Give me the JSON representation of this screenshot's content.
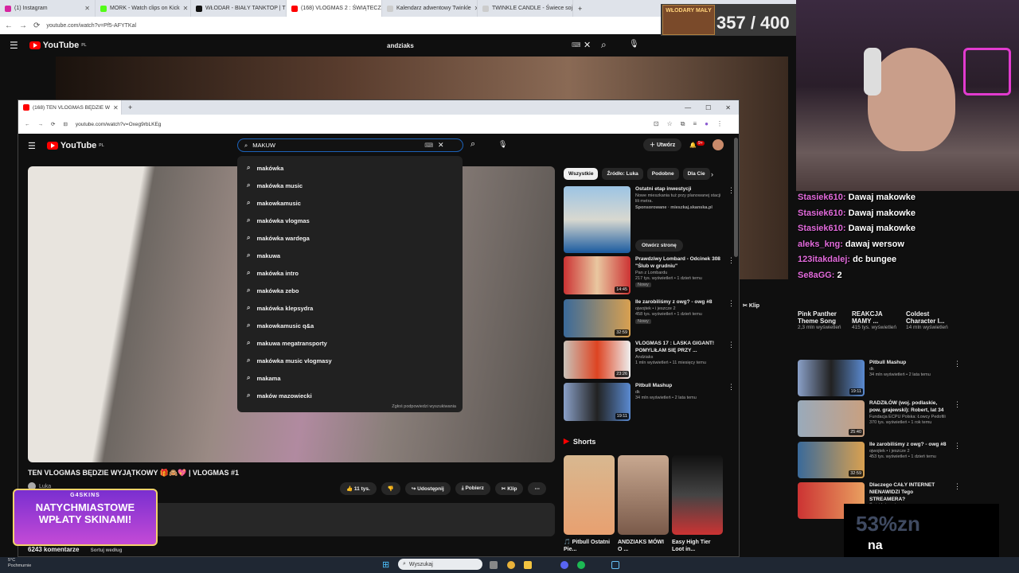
{
  "outer_tabs": [
    {
      "label": "(1) Instagram",
      "color": "#d6249f"
    },
    {
      "label": "MORK - Watch clips on Kick",
      "color": "#53fc18"
    },
    {
      "label": "WŁODAR - BIAŁY TANKTOP | T",
      "color": "#111111"
    },
    {
      "label": "(168) VLOGMAS 2 : ŚWIĄTECZ",
      "color": "#ff0000"
    },
    {
      "label": "Kalendarz adwentowy Twinkle",
      "color": "#cccccc"
    },
    {
      "label": "TWINKLE CANDLE - Świece soj",
      "color": "#cccccc"
    }
  ],
  "outer_url": "youtube.com/watch?v=Pf5-AFYTKal",
  "outer_logo": "YouTube",
  "outer_logo_region": "PL",
  "outer_search_value": "andziaks",
  "counter_badge": "WŁODARY MAŁY",
  "counter": "357 / 400",
  "inner_tab": "(168) TEN VLOGMAS BĘDZIE W",
  "inner_url": "youtube.com/watch?v=Oxeg9rbLKEg",
  "inner_search_value": "MAKUW",
  "suggestions": [
    "makówka",
    "makówka music",
    "makowkamusic",
    "makówka vlogmas",
    "makówka wardega",
    "makuwa",
    "makówka intro",
    "makówka zebo",
    "makówka klepsydra",
    "makowkamusic q&a",
    "makuwa megatransporty",
    "makówka music vlogmasy",
    "makama",
    "maków mazowiecki"
  ],
  "suggest_footer": "Zgłoś podpowiedzi wyszukiwania",
  "create_label": "Utwórz",
  "notif_count": "9+",
  "video_title": "TEN VLOGMAS BĘDZIE WYJĄTKOWY 🎁🙈💖 | VLOGMAS #1",
  "channel": "Luka",
  "actions": {
    "likes": "11 tys.",
    "share": "Udostępnij",
    "download": "Pobierz",
    "clip": "Klip"
  },
  "comments_count": "6243 komentarze",
  "sort_label": "Sortuj według",
  "chips": [
    "Wszystkie",
    "Źródło: Luka",
    "Podobne",
    "Dla Cie"
  ],
  "ad": {
    "title": "Ostatni etap inwestycji",
    "desc": "Nowe mieszkania tuż przy planowanej stacji lili metra.",
    "sponsor": "Sponsorowane · mieszkaj.skanska.pl",
    "cta": "Otwórz stronę"
  },
  "recos": [
    {
      "title": "Prawdziwy Lombard - Odcinek 308 \"Ślub w grudniu\"",
      "channel": "Pan z Lombardu",
      "meta": "217 tys. wyświetleń • 1 dzień temu",
      "badge": "Nowy",
      "dur": "14:45"
    },
    {
      "title": "Ile zarobiliśmy z owg? - owg #8",
      "channel": "ojwojtek • i jeszcze 2",
      "meta": "458 tys. wyświetleń • 1 dzień temu",
      "badge": "Nowy",
      "dur": "32:59"
    },
    {
      "title": "VLOGMAS 17 : LASKA GIGANT! POMYLIŁAM SIĘ PRZY ...",
      "channel": "Andziaks",
      "meta": "1 mln wyświetleń • 11 miesięcy temu",
      "badge": "",
      "dur": "23:26"
    },
    {
      "title": "Pitbull Mashup",
      "channel": "dk",
      "meta": "34 mln wyświetleń • 2 lata temu",
      "badge": "",
      "dur": "19:11"
    }
  ],
  "shorts_label": "Shorts",
  "shorts": [
    {
      "title": "🎵 Pitbull Ostatni Pie..."
    },
    {
      "title": "ANDZIAKS MÓWI O ..."
    },
    {
      "title": "Easy High Tier Loot in..."
    }
  ],
  "chat": [
    {
      "user": "Stasiek610:",
      "msg": " Dawaj makowke"
    },
    {
      "user": "Stasiek610:",
      "msg": " Dawaj makowke"
    },
    {
      "user": "Stasiek610:",
      "msg": " Dawaj makowke"
    },
    {
      "user": "aleks_kng:",
      "msg": " dawaj wersow"
    },
    {
      "user": "123itakdalej:",
      "msg": " dc bungee"
    },
    {
      "user": "Se8aGG:",
      "msg": " 2"
    }
  ],
  "right_cards": [
    {
      "title": "Pink Panther Theme Song",
      "meta": "2,3 mln wyświetleń"
    },
    {
      "title": "REAKCJA MAMY ...",
      "meta": "415 tys. wyświetleń"
    },
    {
      "title": "Coldest Character I...",
      "meta": "14 mln wyświetleń"
    }
  ],
  "right_list": [
    {
      "title": "Pitbull Mashup",
      "channel": "dk",
      "meta": "34 mln wyświetleń • 2 lata temu",
      "dur": "19:11"
    },
    {
      "title": "RADZIŁÓW (woj. podlaskie, pow. grajewski): Robert, lat 34",
      "channel": "Fundacja ECPU Polska: Łowcy Pedofili",
      "meta": "370 tys. wyświetleń • 1 rok temu",
      "dur": "25:40"
    },
    {
      "title": "Ile zarobiliśmy z owg? - owg #8",
      "channel": "ojwojtek • i jeszcze 2",
      "meta": "453 tys. wyświetleń • 1 dzień temu",
      "dur": "32:59"
    },
    {
      "title": "Dlaczego CAŁY INTERNET NIENAWIDZI Tego STREAMERA?",
      "channel": "Świat Internetu",
      "meta": "",
      "dur": ""
    }
  ],
  "outer_clip": "Klip",
  "promo": {
    "brand": "G4SKINS",
    "line1": "NATYCHMIASTOWE",
    "line2": "WPŁATY SKINAMI!"
  },
  "overlay": {
    "blur": "53%zn",
    "text": "na"
  },
  "taskbar": {
    "weather_temp": "5°C",
    "weather_desc": "Pochmurnie",
    "search": "Wyszukaj"
  }
}
